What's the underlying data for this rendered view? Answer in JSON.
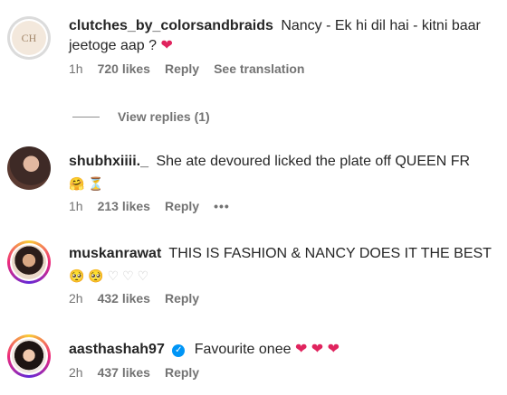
{
  "comments": [
    {
      "username": "clutches_by_colorsandbraids",
      "text": "Nancy - Ek hi dil hai - kitni baar jeetoge aap ?",
      "text_suffix": "❤",
      "time": "1h",
      "likes": "720 likes",
      "reply_label": "Reply",
      "translate_label": "See translation",
      "avatar_initials": "CH"
    },
    {
      "username": "shubhxiiii._",
      "text": "She ate devoured licked the plate off QUEEN FR",
      "emoji_line": [
        "🤗",
        "⏳"
      ],
      "time": "1h",
      "likes": "213 likes",
      "reply_label": "Reply",
      "more_label": "•••"
    },
    {
      "username": "muskanrawat",
      "text": "THIS IS FASHION & NANCY DOES IT THE BEST",
      "emoji_line": [
        "🥺",
        "🥺",
        "♡",
        "♡",
        "♡"
      ],
      "time": "2h",
      "likes": "432 likes",
      "reply_label": "Reply"
    },
    {
      "username": "aasthashah97",
      "text": "Favourite onee",
      "text_suffix": "❤ ❤ ❤",
      "time": "2h",
      "likes": "437 likes",
      "reply_label": "Reply"
    }
  ],
  "view_replies_label": "View replies (1)",
  "colors": {
    "heart": "#e0245e",
    "verified": "#0095f6",
    "meta_text": "#737373"
  }
}
